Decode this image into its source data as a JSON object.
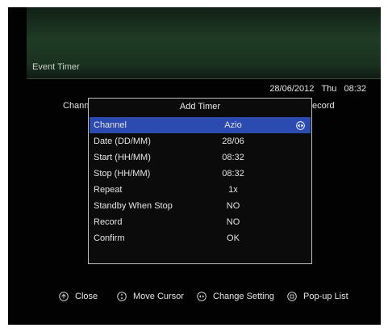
{
  "screen": {
    "title": "Event Timer",
    "date": "28/06/2012",
    "weekday": "Thu",
    "time": "08:32",
    "bg_left_label": "Chann",
    "bg_right_label": "t Record"
  },
  "dialog": {
    "title": "Add Timer",
    "rows": [
      {
        "label": "Channel",
        "value": "Azio"
      },
      {
        "label": "Date (DD/MM)",
        "value": "28/06"
      },
      {
        "label": "Start (HH/MM)",
        "value": "08:32"
      },
      {
        "label": "Stop (HH/MM)",
        "value": "08:32"
      },
      {
        "label": "Repeat",
        "value": "1x"
      },
      {
        "label": "Standby When Stop",
        "value": "NO"
      },
      {
        "label": "Record",
        "value": "NO"
      },
      {
        "label": "Confirm",
        "value": "OK"
      }
    ],
    "selected_index": 0,
    "selected_color": "#2b4bb0",
    "selected_icon": "left-right-arrows-icon"
  },
  "footer": {
    "close": {
      "label": "Close",
      "icon": "exit-key-icon"
    },
    "move": {
      "label": "Move Cursor",
      "icon": "navigation-arrows-icon"
    },
    "change": {
      "label": "Change Setting",
      "icon": "left-right-key-icon"
    },
    "popup": {
      "label": "Pop-up List",
      "icon": "ok-key-icon"
    }
  }
}
